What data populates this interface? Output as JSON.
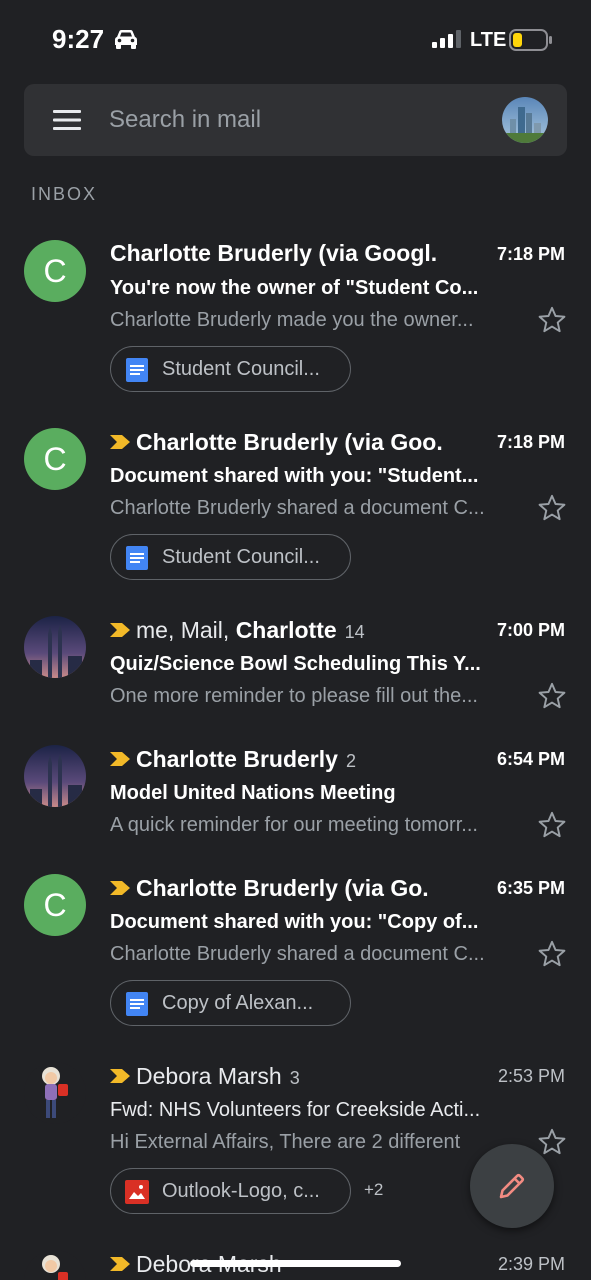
{
  "status_bar": {
    "time": "9:27",
    "network": "LTE"
  },
  "search": {
    "placeholder": "Search in mail"
  },
  "section_label": "INBOX",
  "emails": [
    {
      "sender": "Charlotte Bruderly (via Googl.",
      "time": "7:18 PM",
      "subject": "You're now the owner of \"Student Co...",
      "snippet": "Charlotte Bruderly made you the owner...",
      "attachment": "Student Council...",
      "avatar_letter": "C",
      "important": false,
      "unread": true
    },
    {
      "sender": "Charlotte Bruderly (via Goo.",
      "time": "7:18 PM",
      "subject": "Document shared with you: \"Student...",
      "snippet": "Charlotte Bruderly shared a document C...",
      "attachment": "Student Council...",
      "avatar_letter": "C",
      "important": true,
      "unread": true
    },
    {
      "sender_prefix": "me, Mail, ",
      "sender": "Charlotte",
      "count": "14",
      "time": "7:00 PM",
      "subject": "Quiz/Science Bowl Scheduling This Y...",
      "snippet": "One more reminder to please fill out the...",
      "important": true,
      "unread": true
    },
    {
      "sender": "Charlotte Bruderly",
      "count": "2",
      "time": "6:54 PM",
      "subject": "Model United Nations Meeting",
      "snippet": "A quick reminder for our meeting tomorr...",
      "important": true,
      "unread": true
    },
    {
      "sender": "Charlotte Bruderly (via Go.",
      "time": "6:35 PM",
      "subject": "Document shared with you: \"Copy of...",
      "snippet": "Charlotte Bruderly shared a document C...",
      "attachment": "Copy of Alexan...",
      "avatar_letter": "C",
      "important": true,
      "unread": true
    },
    {
      "sender": "Debora Marsh",
      "count": "3",
      "time": "2:53 PM",
      "subject": "Fwd: NHS Volunteers for Creekside Acti...",
      "snippet": "Hi External Affairs, There are 2 different",
      "attachment": "Outlook-Logo, c...",
      "attachment_more": "+2",
      "important": true,
      "unread": false
    },
    {
      "sender": "Debora Marsh",
      "time": "2:39 PM",
      "important": true,
      "unread": false
    }
  ],
  "colors": {
    "background": "#202124",
    "search_bar": "#303134",
    "avatar_green": "#5aad5f",
    "important_marker": "#f2b928",
    "docs_blue": "#4285f4",
    "image_red": "#d93025",
    "compose_pen": "#f28b82"
  },
  "icons": [
    "car-icon",
    "signal-icon",
    "battery-icon",
    "menu-icon",
    "star-icon",
    "important-marker-icon",
    "docs-icon",
    "image-icon",
    "pencil-icon"
  ]
}
